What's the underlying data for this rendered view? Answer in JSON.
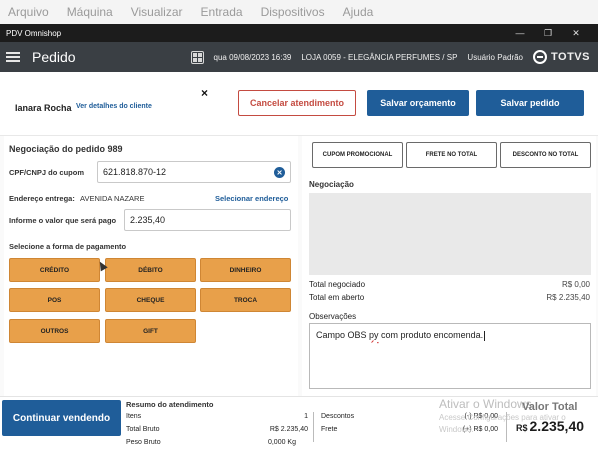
{
  "vm_menu": [
    "Arquivo",
    "Máquina",
    "Visualizar",
    "Entrada",
    "Dispositivos",
    "Ajuda"
  ],
  "window": {
    "title": "PDV Omnishop",
    "controls": [
      "minimize-icon",
      "restore-icon",
      "close-icon"
    ]
  },
  "header": {
    "title": "Pedido",
    "datetime": "qua 09/08/2023 16:39",
    "store": "LOJA 0059 - ELEGÂNCIA PERFUMES / SP",
    "user": "Usuário Padrão",
    "brand": "TOTVS"
  },
  "customer": {
    "name": "Ianara Rocha",
    "details_link": "Ver detalhes do cliente",
    "close_icon": "×",
    "cancel_label": "Cancelar atendimento",
    "save_quote_label": "Salvar orçamento",
    "save_order_label": "Salvar pedido"
  },
  "negotiation": {
    "title": "Negociação do pedido 989",
    "cpf_label": "CPF/CNPJ do cupom",
    "cpf_value": "621.818.870-12",
    "address_label": "Endereço entrega:",
    "address_value": "AVENIDA NAZARE",
    "address_link": "Selecionar endereço",
    "amount_label": "Informe o valor que será pago",
    "amount_value": "2.235,40",
    "payment_title": "Selecione a forma de pagamento",
    "payment_methods": [
      "CRÉDITO",
      "DÉBITO",
      "DINHEIRO",
      "POS",
      "CHEQUE",
      "TROCA",
      "OUTROS",
      "GIFT"
    ]
  },
  "right": {
    "buttons": [
      "CUPOM PROMOCIONAL",
      "FRETE NO TOTAL",
      "DESCONTO NO TOTAL"
    ],
    "negotiation_title": "Negociação",
    "total_negotiated_label": "Total negociado",
    "total_negotiated_value": "R$ 0,00",
    "total_open_label": "Total em aberto",
    "total_open_value": "R$ 2.235,40",
    "obs_title": "Observações",
    "obs_before": "Campo OBS ",
    "obs_misspelled": "py",
    "obs_after": " com produto encomenda."
  },
  "footer": {
    "continue_label": "Continuar vendendo",
    "summary_title": "Resumo do atendimento",
    "items_label": "Itens",
    "items_value": "1",
    "gross_total_label": "Total Bruto",
    "gross_total_value": "R$ 2.235,40",
    "gross_weight_label": "Peso Bruto",
    "gross_weight_value": "0,000 Kg",
    "discounts_label": "Descontos",
    "discounts_value": "(-) R$ 0,00",
    "freight_label": "Frete",
    "freight_value": "(+) R$ 0,00",
    "total_label": "Valor Total",
    "total_currency": "R$",
    "total_value": "2.235,40"
  },
  "os_watermark": {
    "title": "Ativar o Windows",
    "text": "Acesse Configurações para ativar o Windows."
  },
  "colors": {
    "primary": "#1f5d99",
    "danger": "#c44b41",
    "payment": "#e8a04a",
    "header": "#3a3f44"
  }
}
